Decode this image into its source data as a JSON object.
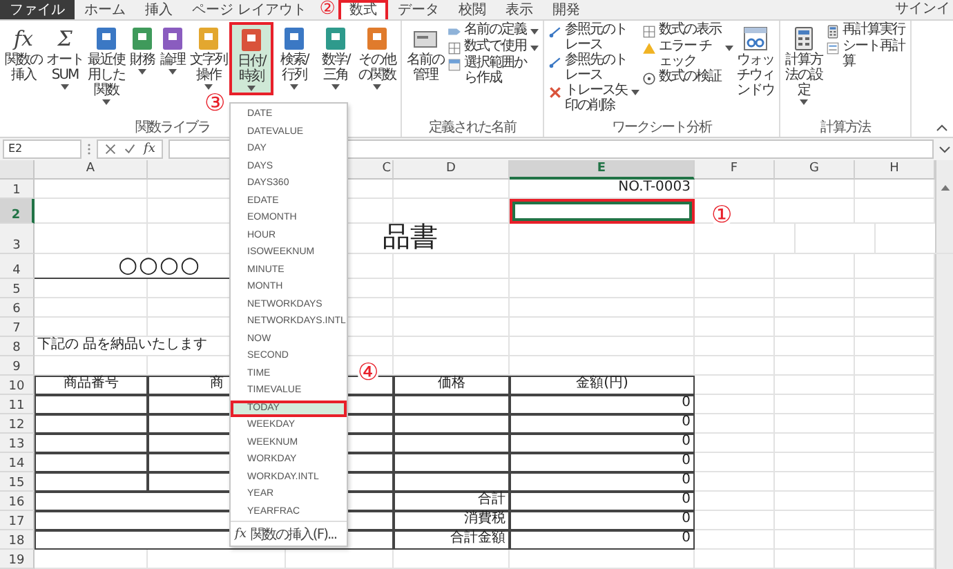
{
  "tabs": [
    {
      "label": "ファイル",
      "kind": "file",
      "selected": false,
      "highlighted": false
    },
    {
      "label": "ホーム",
      "kind": "tab",
      "selected": false,
      "highlighted": false
    },
    {
      "label": "挿入",
      "kind": "tab",
      "selected": false,
      "highlighted": false
    },
    {
      "label": "ページ レイアウト",
      "kind": "tab",
      "selected": false,
      "highlighted": false
    },
    {
      "label": "数式",
      "kind": "tab",
      "selected": true,
      "highlighted": true
    },
    {
      "label": "データ",
      "kind": "tab",
      "selected": false,
      "highlighted": false
    },
    {
      "label": "校閲",
      "kind": "tab",
      "selected": false,
      "highlighted": false
    },
    {
      "label": "表示",
      "kind": "tab",
      "selected": false,
      "highlighted": false
    },
    {
      "label": "開発",
      "kind": "tab",
      "selected": false,
      "highlighted": false
    }
  ],
  "account": "サインイ",
  "ribbon": {
    "groups": [
      {
        "label": "関数ライブラ",
        "controls": [
          {
            "kind": "large",
            "glyph": "fx",
            "label": "関数の挿入",
            "menu": false,
            "expanded": false,
            "highlighted": false
          },
          {
            "kind": "large",
            "glyph": "Σ",
            "label": "オートSUM",
            "menu": true,
            "expanded": false,
            "highlighted": false
          },
          {
            "kind": "large",
            "label": "最近使用した関数",
            "menu": true,
            "expanded": false,
            "highlighted": false
          },
          {
            "kind": "large",
            "label": "財務",
            "menu": true,
            "expanded": false,
            "highlighted": false
          },
          {
            "kind": "large",
            "label": "論理",
            "menu": true,
            "expanded": false,
            "highlighted": false
          },
          {
            "kind": "large",
            "label": "文字列操作",
            "menu": true,
            "expanded": false,
            "highlighted": false
          },
          {
            "kind": "large",
            "label": "日付/時刻",
            "menu": true,
            "expanded": true,
            "highlighted": true,
            "dropdown": {
              "items": [
                {
                  "label": "DATE",
                  "selected": false
                },
                {
                  "label": "DATEVALUE",
                  "selected": false
                },
                {
                  "label": "DAY",
                  "selected": false
                },
                {
                  "label": "DAYS",
                  "selected": false
                },
                {
                  "label": "DAYS360",
                  "selected": false
                },
                {
                  "label": "EDATE",
                  "selected": false
                },
                {
                  "label": "EOMONTH",
                  "selected": false
                },
                {
                  "label": "HOUR",
                  "selected": false
                },
                {
                  "label": "ISOWEEKNUM",
                  "selected": false
                },
                {
                  "label": "MINUTE",
                  "selected": false
                },
                {
                  "label": "MONTH",
                  "selected": false
                },
                {
                  "label": "NETWORKDAYS",
                  "selected": false
                },
                {
                  "label": "NETWORKDAYS.INTL",
                  "selected": false
                },
                {
                  "label": "NOW",
                  "selected": false
                },
                {
                  "label": "SECOND",
                  "selected": false
                },
                {
                  "label": "TIME",
                  "selected": false
                },
                {
                  "label": "TIMEVALUE",
                  "selected": false
                },
                {
                  "label": "TODAY",
                  "selected": true
                },
                {
                  "label": "WEEKDAY",
                  "selected": false
                },
                {
                  "label": "WEEKNUM",
                  "selected": false
                },
                {
                  "label": "WORKDAY",
                  "selected": false
                },
                {
                  "label": "WORKDAY.INTL",
                  "selected": false
                },
                {
                  "label": "YEAR",
                  "selected": false
                },
                {
                  "label": "YEARFRAC",
                  "selected": false
                }
              ],
              "footer": {
                "glyph": "fx",
                "label": "関数の挿入(F)..."
              }
            }
          },
          {
            "kind": "large",
            "label": "検索/行列",
            "menu": true,
            "expanded": false,
            "highlighted": false
          },
          {
            "kind": "large",
            "label": "数学/三角",
            "menu": true,
            "expanded": false,
            "highlighted": false
          },
          {
            "kind": "large",
            "label": "その他の関数",
            "menu": true,
            "expanded": false,
            "highlighted": false
          }
        ]
      },
      {
        "label": "定義された名前",
        "controls": [
          {
            "kind": "large",
            "label": "名前の管理",
            "menu": false,
            "expanded": false,
            "highlighted": false
          },
          {
            "kind": "stack",
            "items": [
              {
                "label": "名前の定義",
                "menu": true
              },
              {
                "label": "数式で使用",
                "menu": true
              },
              {
                "label": "選択範囲から作成",
                "menu": false
              }
            ]
          }
        ]
      },
      {
        "label": "ワークシート分析",
        "controls": [
          {
            "kind": "stack",
            "items": [
              {
                "label": "参照元のトレース",
                "menu": false
              },
              {
                "label": "参照先のトレース",
                "menu": false
              },
              {
                "label": "トレース矢印の削除",
                "menu": true
              }
            ]
          },
          {
            "kind": "stack",
            "items": [
              {
                "label": "数式の表示",
                "menu": false
              },
              {
                "label": "エラー チェック",
                "menu": true
              },
              {
                "label": "数式の検証",
                "menu": false
              }
            ]
          },
          {
            "kind": "large",
            "label": "ウォッチウィンドウ",
            "menu": false,
            "expanded": false,
            "highlighted": false
          }
        ]
      },
      {
        "label": "計算方法",
        "controls": [
          {
            "kind": "large",
            "label": "計算方法の設定",
            "menu": true,
            "expanded": false,
            "highlighted": false
          },
          {
            "kind": "stack",
            "items": [
              {
                "label": "再計算実行",
                "menu": false
              },
              {
                "label": "シート再計算",
                "menu": false
              }
            ]
          }
        ]
      }
    ]
  },
  "formula_bar": {
    "name_box": "E2",
    "fx": "fx"
  },
  "sheet": {
    "columns": [
      {
        "label": "A",
        "selected": false
      },
      {
        "selected": false
      },
      {
        "label": "C",
        "selected": false
      },
      {
        "label": "D",
        "selected": false
      },
      {
        "label": "E",
        "selected": true
      },
      {
        "label": "F",
        "selected": false
      },
      {
        "label": "G",
        "selected": false
      },
      {
        "label": "H",
        "selected": false
      }
    ],
    "rows": [
      {
        "header": "1",
        "selected": false,
        "highlighted": false,
        "kind": "doc-number",
        "cells": [
          "",
          "",
          "",
          "",
          "NO.T-0003"
        ]
      },
      {
        "header": "2",
        "selected": true,
        "highlighted": true,
        "kind": "plain",
        "cells": []
      },
      {
        "header": "3",
        "selected": false,
        "highlighted": false,
        "kind": "title",
        "cells": [
          "",
          "",
          "品書"
        ]
      },
      {
        "header": "4",
        "selected": false,
        "highlighted": false,
        "kind": "banner",
        "cells": [
          "○○○○"
        ]
      },
      {
        "header": "5",
        "selected": false,
        "highlighted": false,
        "kind": "plain",
        "cells": []
      },
      {
        "header": "6",
        "selected": false,
        "highlighted": false,
        "kind": "plain",
        "cells": []
      },
      {
        "header": "7",
        "selected": false,
        "highlighted": false,
        "kind": "plain",
        "cells": []
      },
      {
        "header": "8",
        "selected": false,
        "highlighted": false,
        "kind": "note",
        "cells": [
          "下記の 品を納品いたします"
        ]
      },
      {
        "header": "9",
        "selected": false,
        "highlighted": false,
        "kind": "plain",
        "cells": []
      },
      {
        "header": "10",
        "selected": false,
        "highlighted": false,
        "kind": "table-head",
        "cells": [
          "商品番号",
          "商",
          "",
          "価格",
          "金額(円)"
        ]
      },
      {
        "header": "11",
        "selected": false,
        "highlighted": false,
        "kind": "table",
        "cells": [
          "",
          "",
          "",
          "",
          "0"
        ]
      },
      {
        "header": "12",
        "selected": false,
        "highlighted": false,
        "kind": "table",
        "cells": [
          "",
          "",
          "",
          "",
          "0"
        ]
      },
      {
        "header": "13",
        "selected": false,
        "highlighted": false,
        "kind": "table",
        "cells": [
          "",
          "",
          "",
          "",
          "0"
        ]
      },
      {
        "header": "14",
        "selected": false,
        "highlighted": false,
        "kind": "table",
        "cells": [
          "",
          "",
          "",
          "",
          "0"
        ]
      },
      {
        "header": "15",
        "selected": false,
        "highlighted": false,
        "kind": "table",
        "cells": [
          "",
          "",
          "",
          "",
          "0"
        ]
      },
      {
        "header": "16",
        "selected": false,
        "highlighted": false,
        "kind": "total",
        "cells": [
          "",
          "",
          "",
          "合計",
          "0"
        ]
      },
      {
        "header": "17",
        "selected": false,
        "highlighted": false,
        "kind": "total",
        "cells": [
          "",
          "",
          "",
          "消費税",
          "0"
        ]
      },
      {
        "header": "18",
        "selected": false,
        "highlighted": false,
        "kind": "total",
        "cells": [
          "",
          "",
          "",
          "合計金額",
          "0"
        ]
      },
      {
        "header": "19",
        "selected": false,
        "highlighted": false,
        "kind": "plain",
        "cells": []
      }
    ]
  },
  "callouts": [
    {
      "text": "②"
    },
    {
      "text": "③"
    },
    {
      "text": "①"
    },
    {
      "text": "④"
    }
  ]
}
